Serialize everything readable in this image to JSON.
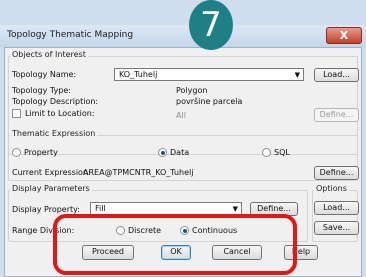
{
  "badge": {
    "step": "7"
  },
  "window": {
    "title": "Topology Thematic Mapping",
    "close_glyph": "X"
  },
  "objects_of_interest": {
    "legend": "Objects of Interest",
    "topology_name_label": "Topology Name:",
    "topology_name_value": "KO_Tuhelj",
    "topology_type_label": "Topology Type:",
    "topology_type_value": "Polygon",
    "topology_description_label": "Topology Description:",
    "topology_description_value": "površine parcela",
    "limit_to_location_label": "Limit to Location:",
    "limit_to_location_value": "All",
    "load_label": "Load...",
    "define_label": "Define..."
  },
  "thematic_expression": {
    "legend": "Thematic Expression",
    "options": [
      {
        "label": "Property",
        "selected": false
      },
      {
        "label": "Data",
        "selected": true
      },
      {
        "label": "SQL",
        "selected": false
      }
    ],
    "current_expression_label": "Current Expression:",
    "current_expression_value": "AREA@TPMCNTR_KO_Tuhelj",
    "define_label": "Define..."
  },
  "display_parameters": {
    "legend": "Display Parameters",
    "display_property_label": "Display Property:",
    "display_property_value": "Fill",
    "define_label": "Define...",
    "range_division_label": "Range Division:",
    "range_options": [
      {
        "label": "Discrete",
        "selected": false
      },
      {
        "label": "Continuous",
        "selected": true
      }
    ]
  },
  "options": {
    "legend": "Options",
    "load_label": "Load...",
    "save_label": "Save..."
  },
  "footer": {
    "proceed_label": "Proceed",
    "ok_label": "OK",
    "cancel_label": "Cancel",
    "help_label": "Help"
  },
  "colors": {
    "badge": "#1f7f86",
    "highlight": "#e01818",
    "title_bar": "#c4d6ea"
  }
}
